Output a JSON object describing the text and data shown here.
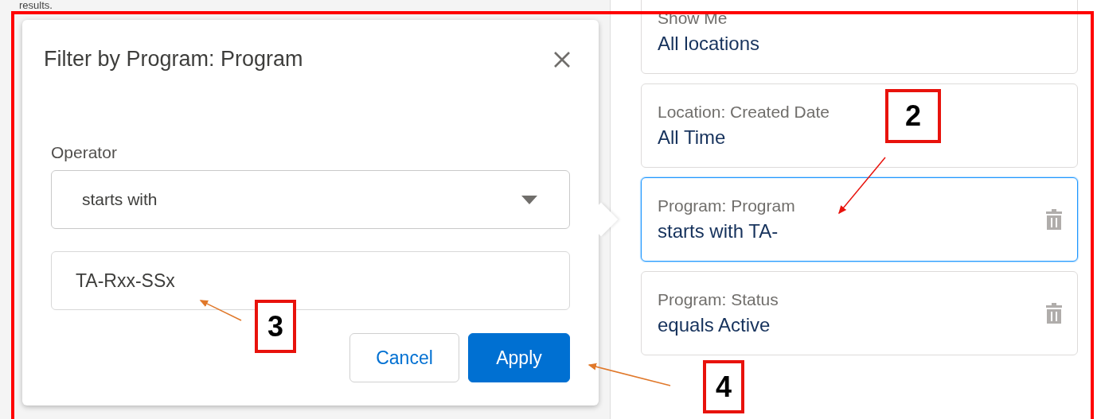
{
  "background_text": "results.",
  "filter_popover": {
    "title": "Filter by Program: Program",
    "operator_label": "Operator",
    "operator": "starts with",
    "value": "TA-Rxx-SSx",
    "buttons": [
      {
        "label": "Cancel",
        "kind": "secondary"
      },
      {
        "label": "Apply",
        "kind": "primary"
      }
    ]
  },
  "filters": [
    {
      "label": "Show Me",
      "value": "All locations",
      "selected": false,
      "removable": false
    },
    {
      "label": "Location: Created Date",
      "value": "All Time",
      "selected": false,
      "removable": false
    },
    {
      "label": "Program: Program",
      "value": "starts with TA-",
      "selected": true,
      "removable": true
    },
    {
      "label": "Program: Status",
      "value": "equals Active",
      "selected": false,
      "removable": true
    }
  ],
  "annotations": [
    {
      "label": "2"
    },
    {
      "label": "3"
    },
    {
      "label": "4"
    }
  ]
}
